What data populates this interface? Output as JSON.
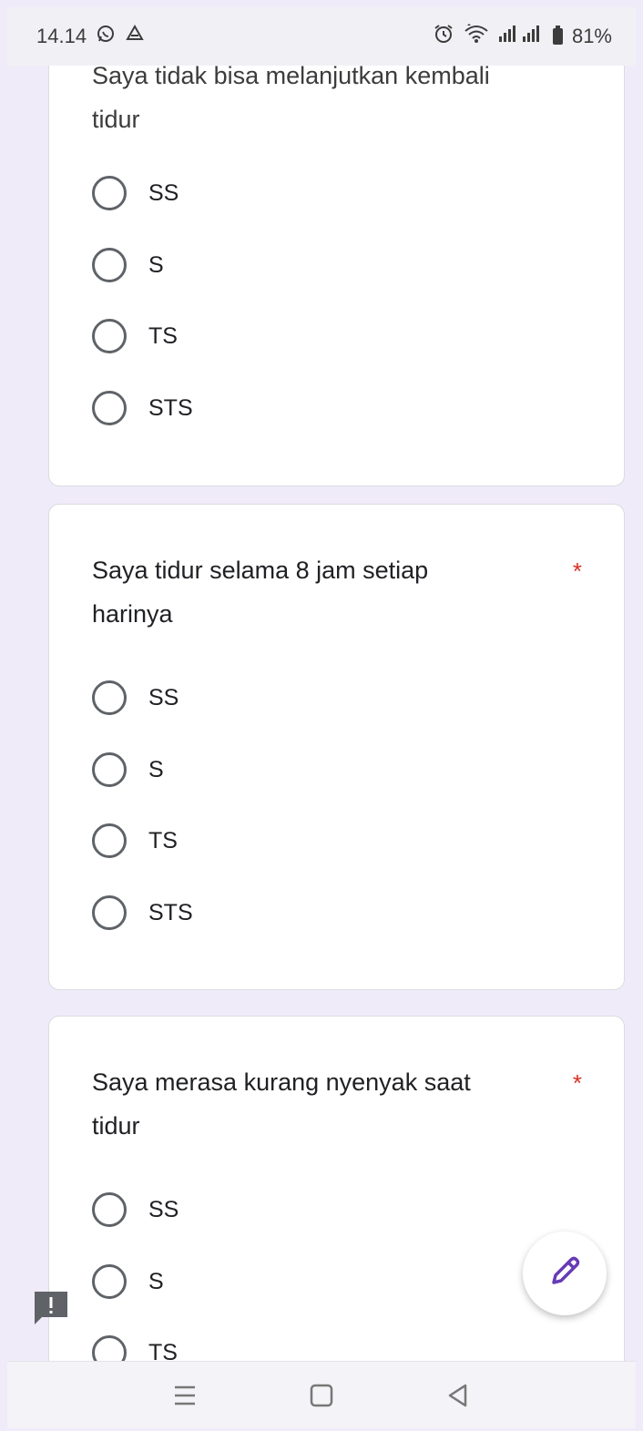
{
  "status_bar": {
    "time": "14.14",
    "battery": "81%",
    "icons": [
      "whatsapp-icon",
      "drive-icon",
      "alarm-icon",
      "wifi-icon",
      "signal-icon",
      "battery-icon"
    ]
  },
  "questions": [
    {
      "title_partial_top": "Saya tidak bisa melanjutkan  kembali",
      "title_line2": "tidur",
      "required": false,
      "options": [
        "SS",
        "S",
        "TS",
        "STS"
      ]
    },
    {
      "title_line1": "Saya tidur selama 8 jam setiap",
      "title_line2": "harinya",
      "required_marker": "*",
      "options": [
        "SS",
        "S",
        "TS",
        "STS"
      ]
    },
    {
      "title_line1": "Saya merasa kurang nyenyak saat",
      "title_line2": "tidur",
      "required_marker": "*",
      "options": [
        "SS",
        "S",
        "TS"
      ]
    }
  ],
  "colors": {
    "background": "#f0ebf8",
    "accent": "#673ab7",
    "required": "#d93025"
  }
}
